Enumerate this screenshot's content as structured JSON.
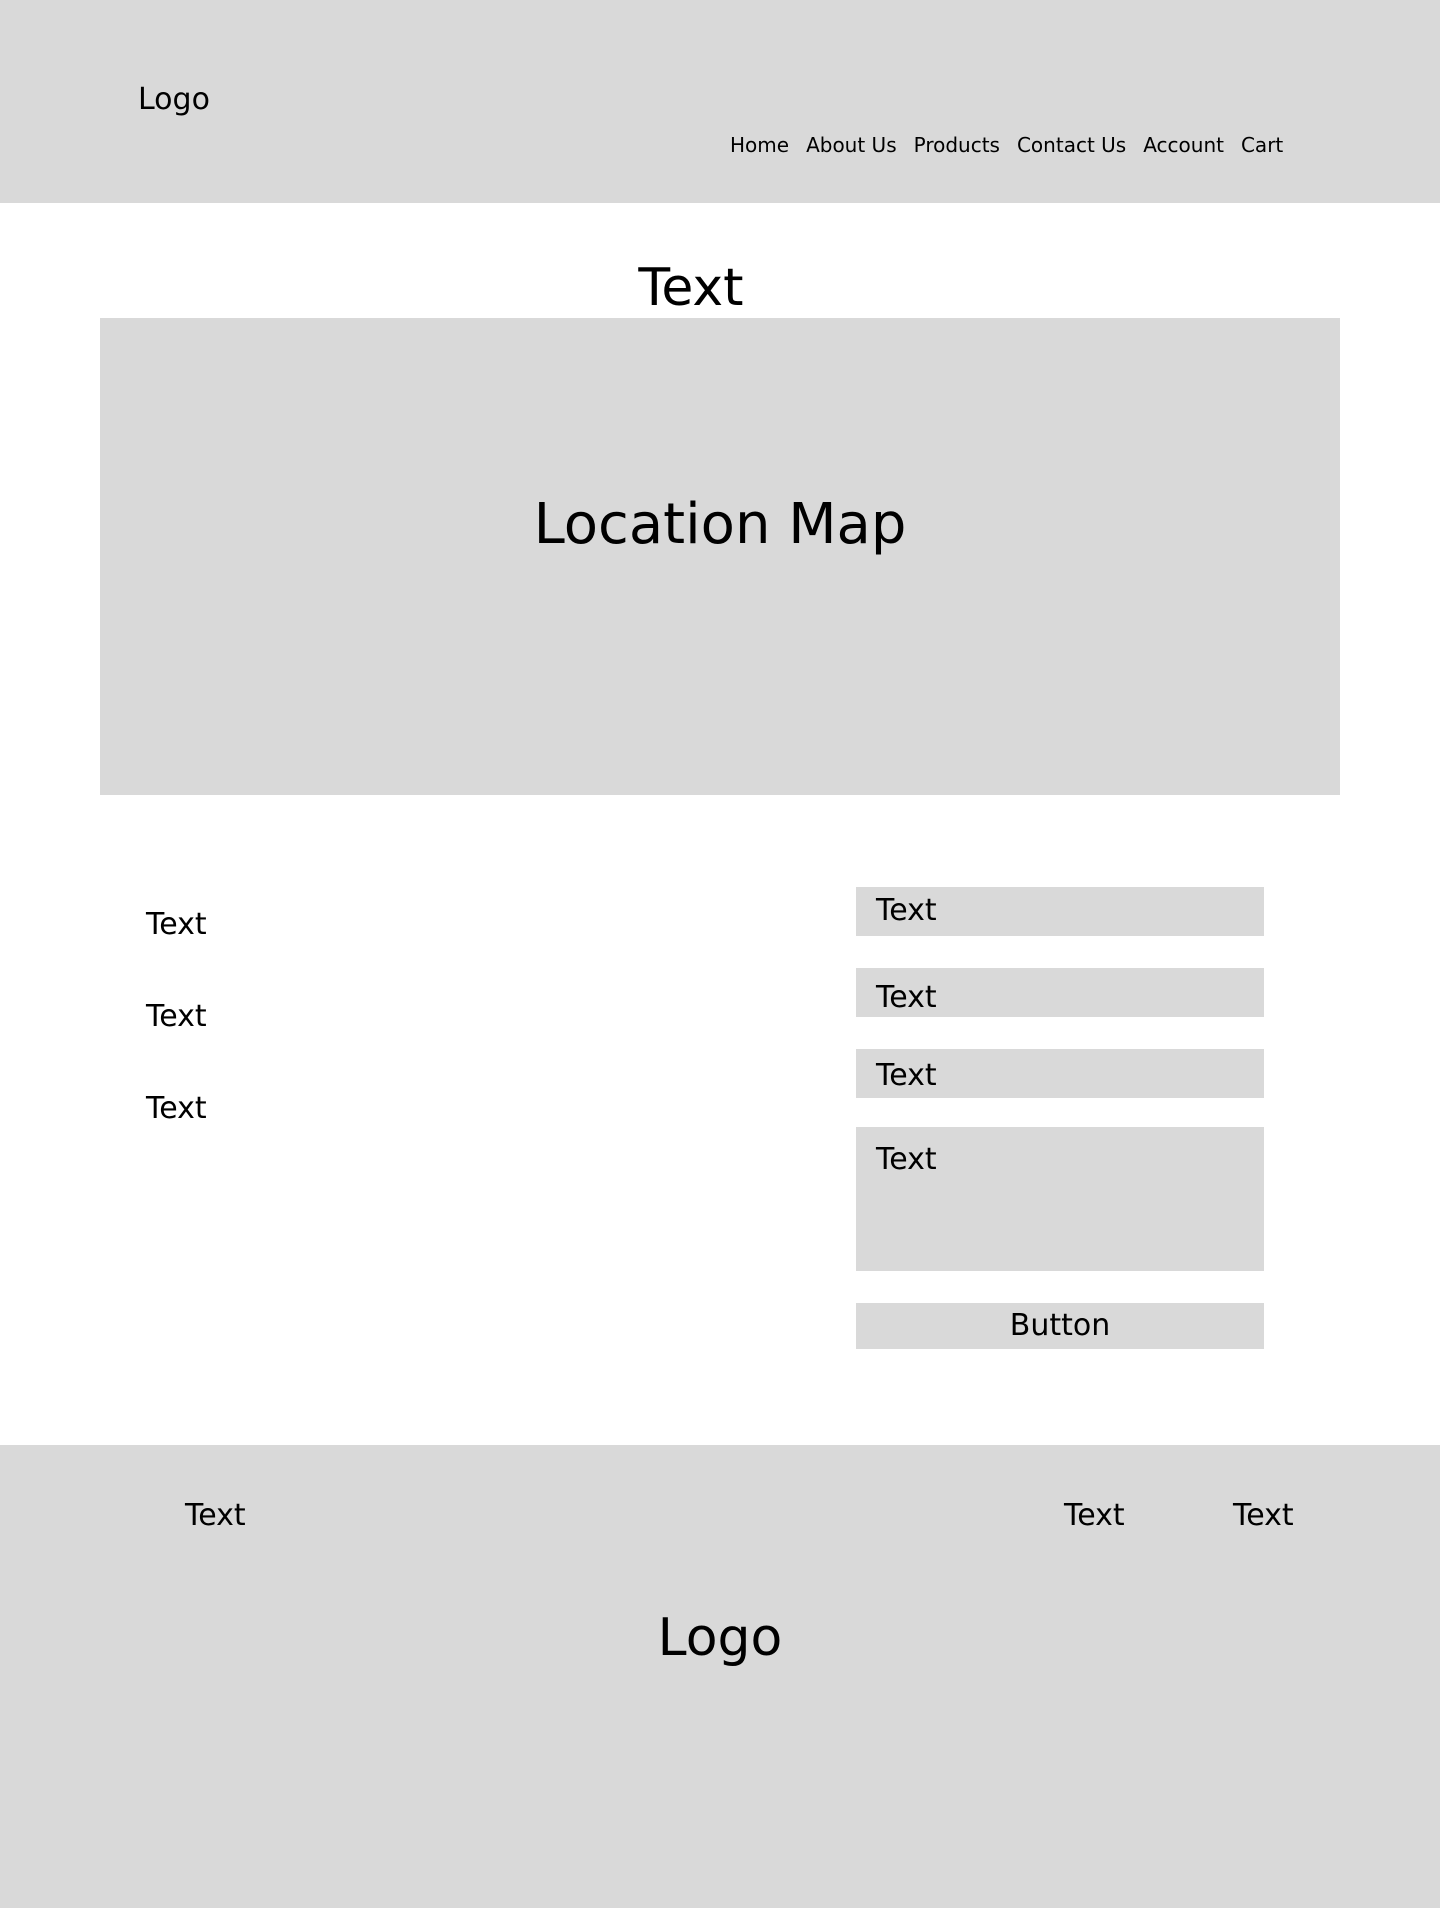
{
  "header": {
    "logo": "Logo",
    "nav": [
      "Home",
      "About Us",
      "Products",
      "Contact Us",
      "Account",
      "Cart"
    ]
  },
  "hero": {
    "title": "Text"
  },
  "map": {
    "label": "Location Map"
  },
  "info": {
    "items": [
      "Text",
      "Text",
      "Text"
    ]
  },
  "form": {
    "fields": [
      "Text",
      "Text",
      "Text",
      "Text"
    ],
    "button": "Button"
  },
  "footer": {
    "left_text": "Text",
    "right_texts": [
      "Text",
      "Text"
    ],
    "logo": "Logo"
  },
  "colors": {
    "placeholder_gray": "#d9d9d9",
    "background": "#ffffff",
    "text": "#000000"
  }
}
